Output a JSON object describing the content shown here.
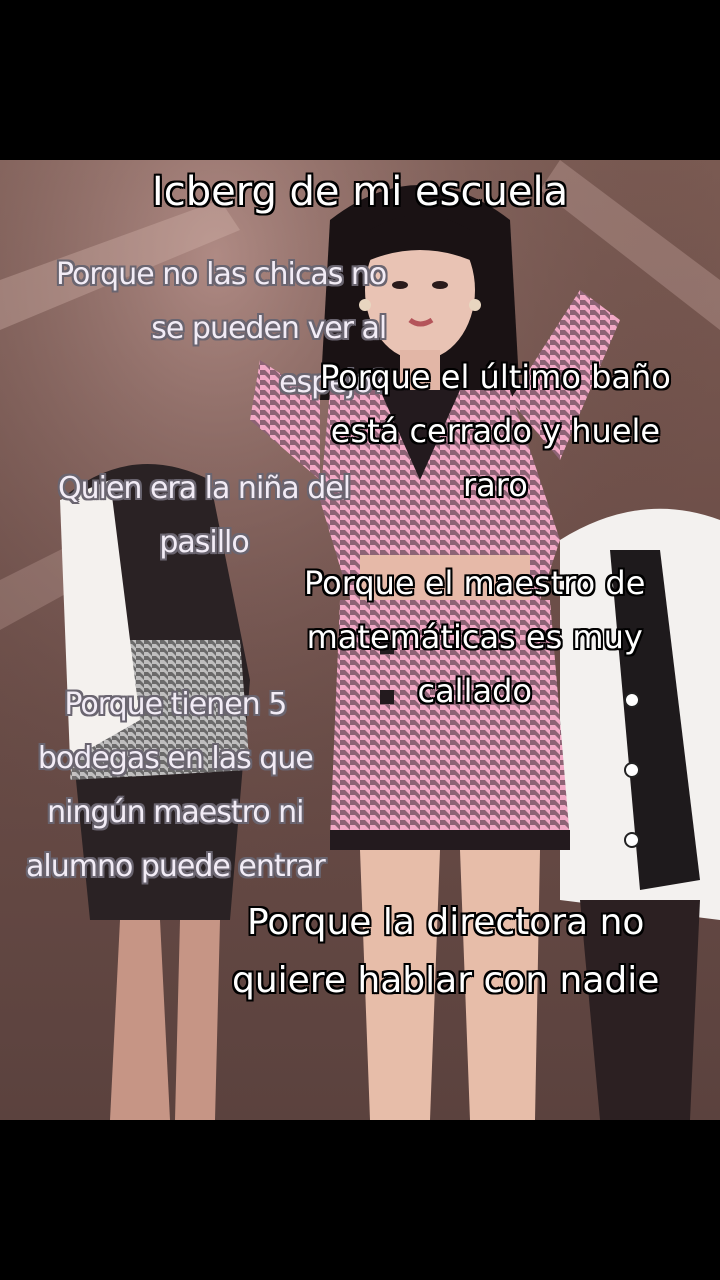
{
  "colors": {
    "letterbox": "#000000",
    "jacket_pink": "#f2a9c6",
    "houndstooth_dark": "#3a2a32",
    "backdrop": "#6e4f49"
  },
  "title": "Icberg de mi escuela",
  "captions": {
    "c1": "Porque no las chicas no\nse pueden ver al\nespejo?",
    "c2": "Porque el último baño\nestá cerrado y huele\nraro",
    "c3": "Quien era la niña del\npasillo",
    "c4": "Porque el maestro de\nmatemáticas es muy\ncallado",
    "c5": "Porque tienen 5\nbodegas en las que\nningún maestro ni\nalumno puede entrar",
    "c6": "Porque la directora no\nquiere hablar con nadie"
  }
}
